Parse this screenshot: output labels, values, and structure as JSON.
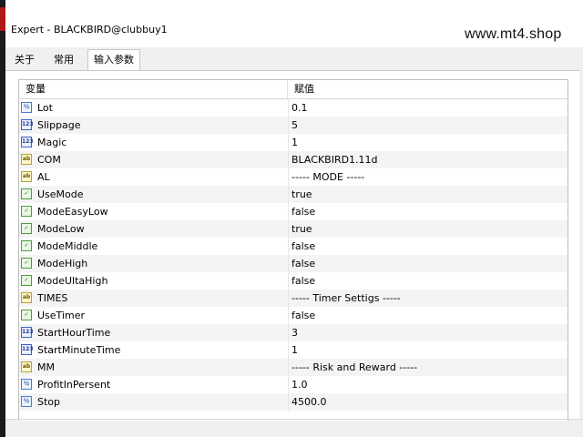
{
  "window": {
    "title": "Expert - BLACKBIRD@clubbuy1"
  },
  "watermark": "www.mt4.shop",
  "tabs": [
    {
      "label": "关于",
      "active": false
    },
    {
      "label": "常用",
      "active": false
    },
    {
      "label": "输入参数",
      "active": true
    }
  ],
  "table": {
    "headers": {
      "variable": "变量",
      "value": "赋值"
    },
    "rows": [
      {
        "icon": "dbl",
        "glyph": "½",
        "name": "Lot",
        "value": "0.1"
      },
      {
        "icon": "num",
        "glyph": "123",
        "name": "Slippage",
        "value": "5"
      },
      {
        "icon": "num",
        "glyph": "123",
        "name": "Magic",
        "value": "1"
      },
      {
        "icon": "str",
        "glyph": "ab",
        "name": "COM",
        "value": "BLACKBIRD1.11d"
      },
      {
        "icon": "str",
        "glyph": "ab",
        "name": "AL",
        "value": "----- MODE -----"
      },
      {
        "icon": "bool",
        "glyph": "✓",
        "name": "UseMode",
        "value": "true"
      },
      {
        "icon": "bool",
        "glyph": "✓",
        "name": "ModeEasyLow",
        "value": "false"
      },
      {
        "icon": "bool",
        "glyph": "✓",
        "name": "ModeLow",
        "value": "true"
      },
      {
        "icon": "bool",
        "glyph": "✓",
        "name": "ModeMiddle",
        "value": "false"
      },
      {
        "icon": "bool",
        "glyph": "✓",
        "name": "ModeHigh",
        "value": "false"
      },
      {
        "icon": "bool",
        "glyph": "✓",
        "name": "ModeUltaHigh",
        "value": "false"
      },
      {
        "icon": "str",
        "glyph": "ab",
        "name": "TIMES",
        "value": "----- Timer Settigs -----"
      },
      {
        "icon": "bool",
        "glyph": "✓",
        "name": "UseTimer",
        "value": "false"
      },
      {
        "icon": "num",
        "glyph": "123",
        "name": "StartHourTime",
        "value": "3"
      },
      {
        "icon": "num",
        "glyph": "123",
        "name": "StartMinuteTime",
        "value": "1"
      },
      {
        "icon": "str",
        "glyph": "ab",
        "name": "MM",
        "value": "----- Risk and Reward -----"
      },
      {
        "icon": "dbl",
        "glyph": "½",
        "name": "ProfitInPersent",
        "value": "1.0"
      },
      {
        "icon": "dbl",
        "glyph": "½",
        "name": "Stop",
        "value": "4500.0"
      }
    ]
  }
}
